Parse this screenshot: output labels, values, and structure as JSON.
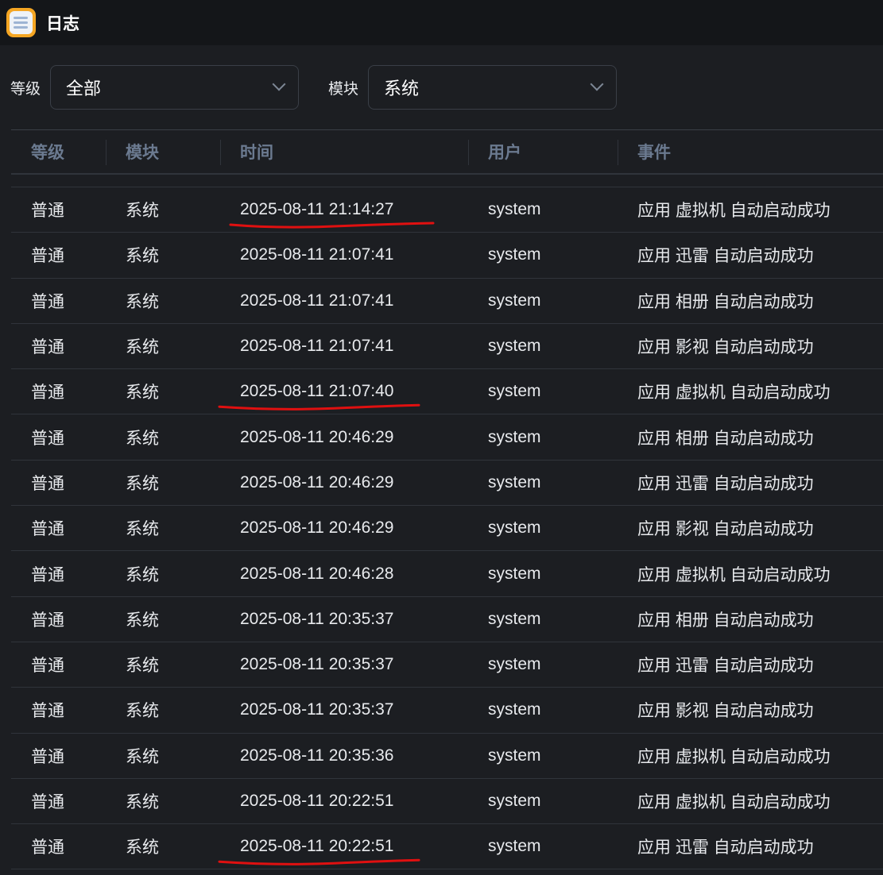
{
  "app": {
    "title": "日志",
    "icon": "clipboard-list-icon",
    "accent": "#f5a623"
  },
  "filters": {
    "level_label": "等级",
    "level_value": "全部",
    "module_label": "模块",
    "module_value": "系统"
  },
  "table": {
    "headers": [
      "等级",
      "模块",
      "时间",
      "用户",
      "事件"
    ],
    "rows": [
      [
        "普通",
        "系统",
        "2025-08-11 21:14:27",
        "system",
        "应用 虚拟机 自动启动成功"
      ],
      [
        "普通",
        "系统",
        "2025-08-11 21:07:41",
        "system",
        "应用 迅雷 自动启动成功"
      ],
      [
        "普通",
        "系统",
        "2025-08-11 21:07:41",
        "system",
        "应用 相册 自动启动成功"
      ],
      [
        "普通",
        "系统",
        "2025-08-11 21:07:41",
        "system",
        "应用 影视 自动启动成功"
      ],
      [
        "普通",
        "系统",
        "2025-08-11 21:07:40",
        "system",
        "应用 虚拟机 自动启动成功"
      ],
      [
        "普通",
        "系统",
        "2025-08-11 20:46:29",
        "system",
        "应用 相册 自动启动成功"
      ],
      [
        "普通",
        "系统",
        "2025-08-11 20:46:29",
        "system",
        "应用 迅雷 自动启动成功"
      ],
      [
        "普通",
        "系统",
        "2025-08-11 20:46:29",
        "system",
        "应用 影视 自动启动成功"
      ],
      [
        "普通",
        "系统",
        "2025-08-11 20:46:28",
        "system",
        "应用 虚拟机 自动启动成功"
      ],
      [
        "普通",
        "系统",
        "2025-08-11 20:35:37",
        "system",
        "应用 相册 自动启动成功"
      ],
      [
        "普通",
        "系统",
        "2025-08-11 20:35:37",
        "system",
        "应用 迅雷 自动启动成功"
      ],
      [
        "普通",
        "系统",
        "2025-08-11 20:35:37",
        "system",
        "应用 影视 自动启动成功"
      ],
      [
        "普通",
        "系统",
        "2025-08-11 20:35:36",
        "system",
        "应用 虚拟机 自动启动成功"
      ],
      [
        "普通",
        "系统",
        "2025-08-11 20:22:51",
        "system",
        "应用 虚拟机 自动启动成功"
      ],
      [
        "普通",
        "系统",
        "2025-08-11 20:22:51",
        "system",
        "应用 迅雷 自动启动成功"
      ]
    ],
    "underlined_rows": [
      0,
      4,
      14
    ],
    "annotation_color": "#e01010"
  }
}
